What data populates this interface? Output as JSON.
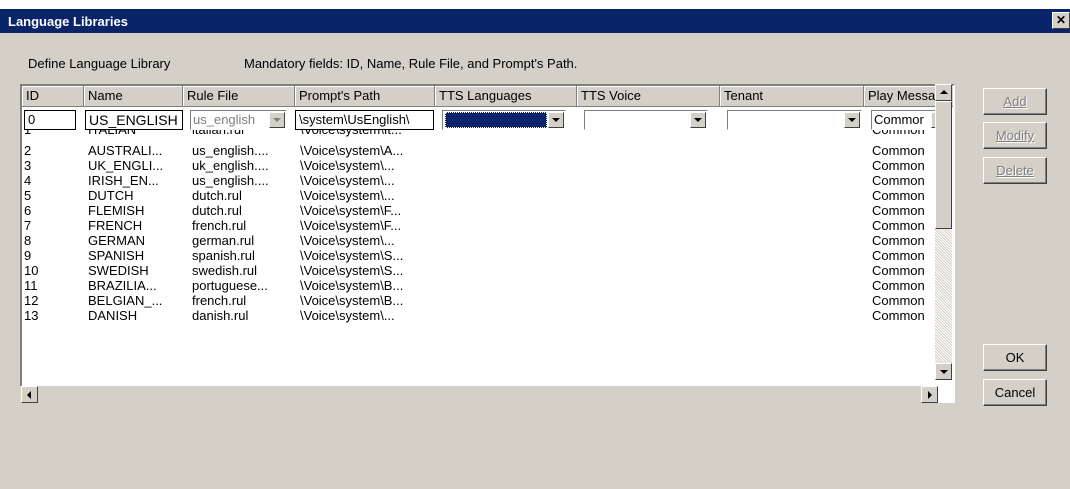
{
  "window": {
    "title": "Language Libraries",
    "close_label": "✕"
  },
  "labels": {
    "define": "Define Language Library",
    "mandatory": "Mandatory fields: ID, Name, Rule File, and Prompt's Path."
  },
  "columns": [
    "ID",
    "Name",
    "Rule File",
    "Prompt's Path",
    "TTS Languages",
    "TTS Voice",
    "Tenant",
    "Play Messa.."
  ],
  "edit_row": {
    "id": "0",
    "name": "US_ENGLISH",
    "rule_file": "us_english",
    "prompt_path": "\\system\\UsEnglish\\",
    "tts_language": "",
    "tts_voice": "",
    "tenant": "",
    "play_message": "Commor"
  },
  "rows": [
    {
      "id": "1",
      "name": "ITALIAN",
      "rule": "italian.rul",
      "path": "\\Voice\\system\\It...",
      "play": "Common"
    },
    {
      "id": "2",
      "name": "AUSTRALI...",
      "rule": "us_english....",
      "path": "\\Voice\\system\\A...",
      "play": "Common"
    },
    {
      "id": "3",
      "name": "UK_ENGLI...",
      "rule": "uk_english....",
      "path": "\\Voice\\system\\...",
      "play": "Common"
    },
    {
      "id": "4",
      "name": "IRISH_EN...",
      "rule": "us_english....",
      "path": "\\Voice\\system\\...",
      "play": "Common"
    },
    {
      "id": "5",
      "name": "DUTCH",
      "rule": "dutch.rul",
      "path": "\\Voice\\system\\...",
      "play": "Common"
    },
    {
      "id": "6",
      "name": "FLEMISH",
      "rule": "dutch.rul",
      "path": "\\Voice\\system\\F...",
      "play": "Common"
    },
    {
      "id": "7",
      "name": "FRENCH",
      "rule": "french.rul",
      "path": "\\Voice\\system\\F...",
      "play": "Common"
    },
    {
      "id": "8",
      "name": "GERMAN",
      "rule": "german.rul",
      "path": "\\Voice\\system\\...",
      "play": "Common"
    },
    {
      "id": "9",
      "name": "SPANISH",
      "rule": "spanish.rul",
      "path": "\\Voice\\system\\S...",
      "play": "Common"
    },
    {
      "id": "10",
      "name": "SWEDISH",
      "rule": "swedish.rul",
      "path": "\\Voice\\system\\S...",
      "play": "Common"
    },
    {
      "id": "11",
      "name": "BRAZILIA...",
      "rule": "portuguese...",
      "path": "\\Voice\\system\\B...",
      "play": "Common"
    },
    {
      "id": "12",
      "name": "BELGIAN_...",
      "rule": "french.rul",
      "path": "\\Voice\\system\\B...",
      "play": "Common"
    },
    {
      "id": "13",
      "name": "DANISH",
      "rule": "danish.rul",
      "path": "\\Voice\\system\\...",
      "play": "Common"
    }
  ],
  "buttons": {
    "add": "Add",
    "modify": "Modify",
    "delete": "Delete",
    "ok": "OK",
    "cancel": "Cancel"
  },
  "colors": {
    "titlebar": "#0a246a",
    "selection": "#0a246a",
    "face": "#d4d0c8"
  }
}
